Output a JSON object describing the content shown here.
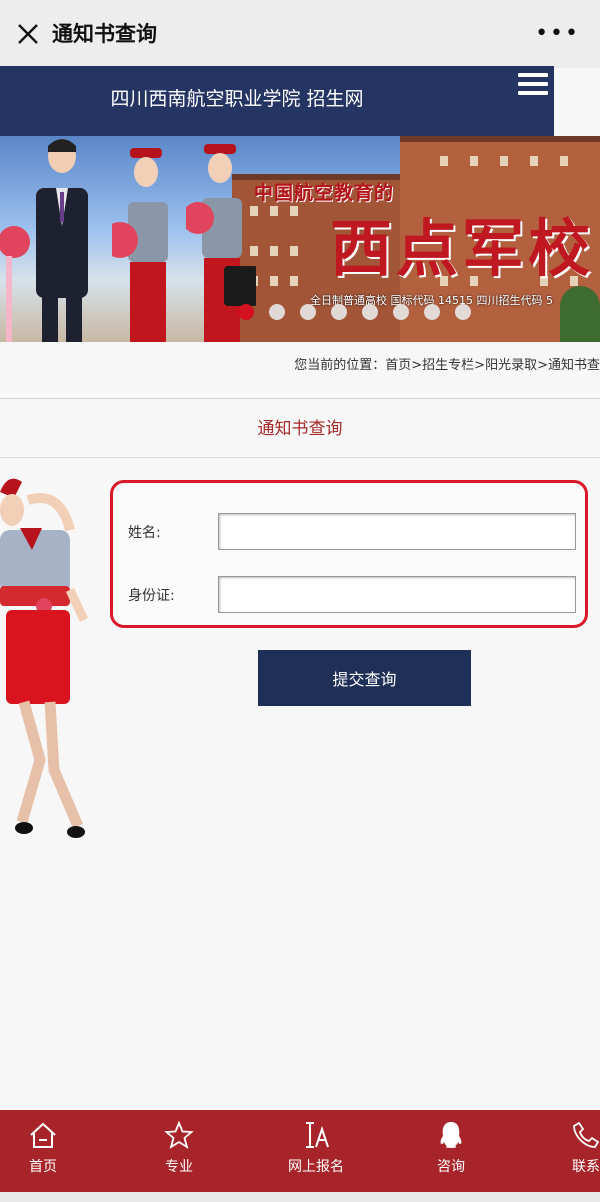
{
  "appbar": {
    "title": "通知书查询",
    "more": "•••"
  },
  "site": {
    "name": "四川西南航空职业学院 招生网"
  },
  "banner": {
    "slogan": "中国航空教育的",
    "headline": "西点军校",
    "codes": "全日制普通高校 国标代码 14515 四川招生代码 5",
    "active_slide": 1,
    "slide_count": 8
  },
  "breadcrumb": {
    "prefix": "您当前的位置：",
    "items": [
      "首页",
      "招生专栏",
      "阳光录取",
      "通知书查"
    ],
    "separator": ">"
  },
  "section_title": "通知书查询",
  "form": {
    "name_label": "姓名:",
    "name_value": "",
    "id_label": "身份证:",
    "id_value": "",
    "submit_label": "提交查询"
  },
  "nav": {
    "items": [
      {
        "label": "首页",
        "icon": "home-icon"
      },
      {
        "label": "专业",
        "icon": "star-icon"
      },
      {
        "label": "网上报名",
        "icon": "text-cursor-icon"
      },
      {
        "label": "咨询",
        "icon": "qq-icon"
      },
      {
        "label": "联系",
        "icon": "phone-icon"
      }
    ]
  },
  "colors": {
    "header_bg": "#243463",
    "accent_red": "#a7242a",
    "form_border": "#d9182a",
    "submit_bg": "#1e2f58"
  }
}
